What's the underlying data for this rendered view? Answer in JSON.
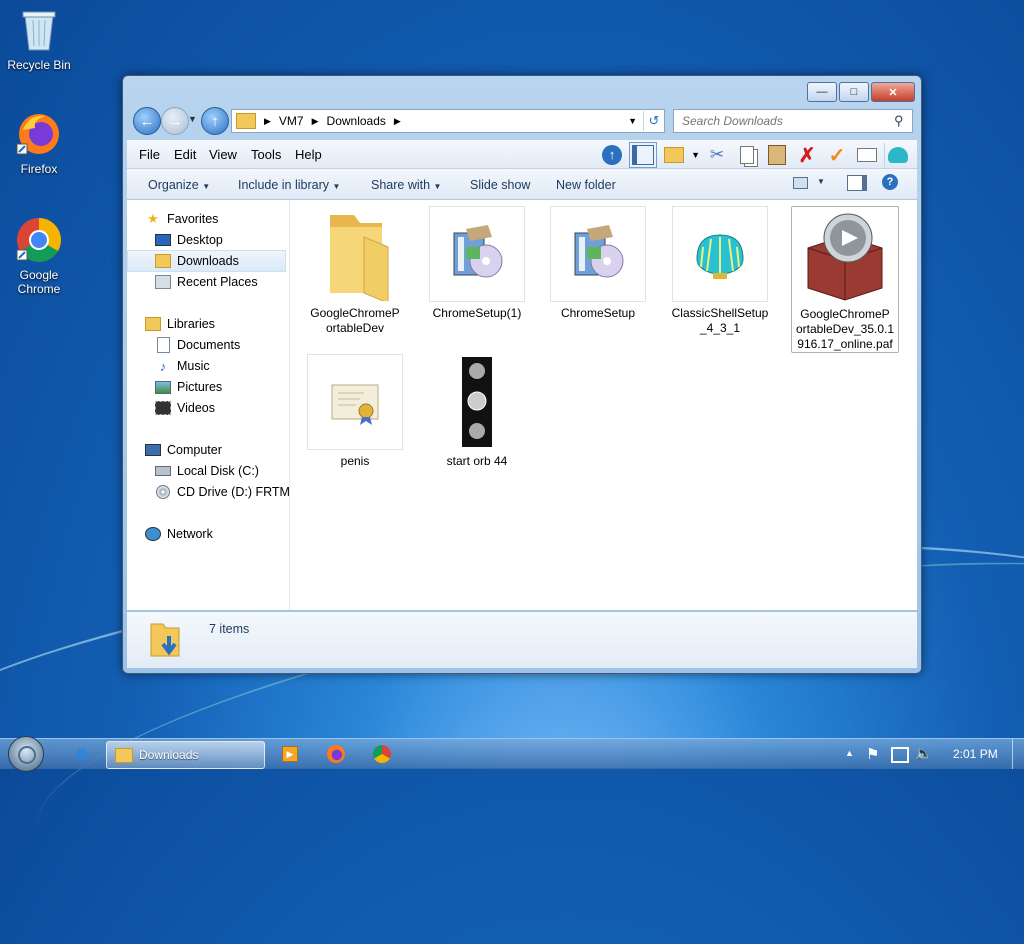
{
  "desktop": {
    "icons": [
      {
        "label": "Recycle Bin"
      },
      {
        "label": "Firefox"
      },
      {
        "label": "Google Chrome"
      }
    ]
  },
  "window": {
    "address": {
      "segments": [
        "VM7",
        "Downloads"
      ]
    },
    "search": {
      "placeholder": "Search Downloads"
    },
    "menu": [
      "File",
      "Edit",
      "View",
      "Tools",
      "Help"
    ],
    "commands": {
      "organize": "Organize",
      "include": "Include in library",
      "share": "Share with",
      "slideshow": "Slide show",
      "newfolder": "New folder"
    },
    "nav": {
      "favorites": "Favorites",
      "desktop": "Desktop",
      "downloads": "Downloads",
      "recent": "Recent Places",
      "libraries": "Libraries",
      "documents": "Documents",
      "music": "Music",
      "pictures": "Pictures",
      "videos": "Videos",
      "computer": "Computer",
      "localdisk": "Local Disk (C:)",
      "cddrive": "CD Drive (D:) FRTME",
      "network": "Network"
    },
    "files": [
      {
        "name": "GoogleChromeP ortableDev",
        "icon": "folder-icon"
      },
      {
        "name": "ChromeSetup(1)",
        "icon": "installer-icon"
      },
      {
        "name": "ChromeSetup",
        "icon": "installer-icon"
      },
      {
        "name": "ClassicShellSetup _4_3_1",
        "icon": "shell-icon"
      },
      {
        "name": "GoogleChromeP ortableDev_35.0.1 916.17_online.paf",
        "icon": "package-icon"
      },
      {
        "name": "penis",
        "icon": "certificate-icon"
      },
      {
        "name": "start orb 44",
        "icon": "orb-strip-icon"
      }
    ],
    "status": {
      "count": "7 items"
    }
  },
  "taskbar": {
    "active_window": "Downloads",
    "clock": "2:01 PM"
  },
  "colors": {
    "accent": "#2b6fc0",
    "close": "#c5402c",
    "folder": "#f2c85a"
  }
}
